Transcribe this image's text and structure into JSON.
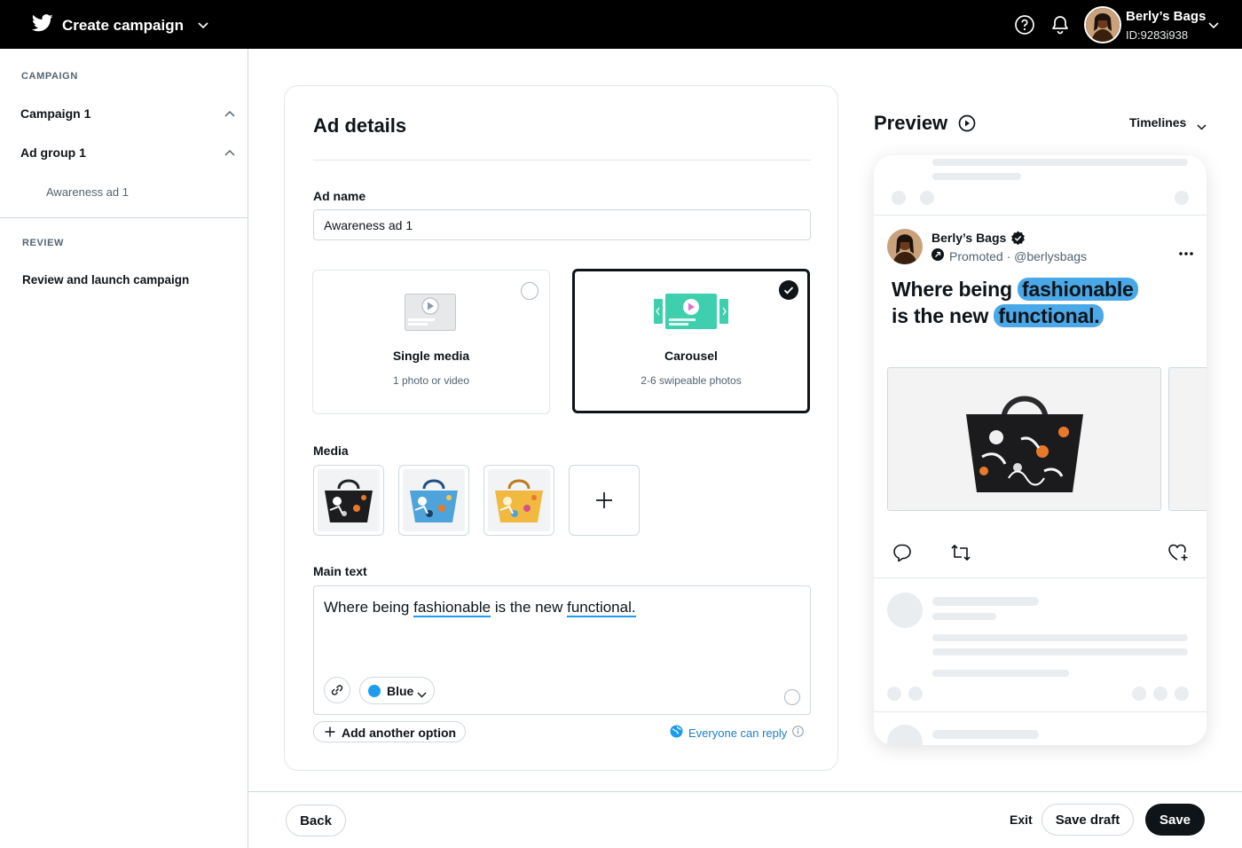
{
  "topbar": {
    "title": "Create campaign",
    "account_name": "Berly’s Bags",
    "account_id": "ID:9283i938"
  },
  "sidebar": {
    "campaign_section": "CAMPAIGN",
    "campaign_item": "Campaign 1",
    "ad_group_item": "Ad group 1",
    "ad_item": "Awareness ad 1",
    "review_section": "REVIEW",
    "review_item": "Review and launch campaign"
  },
  "ad_details": {
    "title": "Ad details",
    "ad_name_label": "Ad name",
    "ad_name_value": "Awareness ad 1",
    "formats": [
      {
        "title": "Single media",
        "desc": "1 photo or video",
        "selected": false
      },
      {
        "title": "Carousel",
        "desc": "2-6 swipeable photos",
        "selected": true
      }
    ],
    "media_label": "Media",
    "main_text_label": "Main text",
    "main_text": {
      "part1": "Where being ",
      "hl1": "fashionable",
      "part2": " is the new ",
      "hl2": "functional."
    },
    "highlight_color": "Blue",
    "highlight_hex": "#1d9bf0",
    "add_option": "Add another option",
    "reply_setting": "Everyone can reply"
  },
  "preview": {
    "title": "Preview",
    "placement": "Timelines",
    "tweet": {
      "name": "Berly’s Bags",
      "promoted": "Promoted · @berlysbags",
      "line1_text": "Where being ",
      "line1_hl": "fashionable",
      "line2_text": "is the new ",
      "line2_hl": "functional."
    }
  },
  "footer": {
    "back": "Back",
    "exit": "Exit",
    "save_draft": "Save draft",
    "save": "Save"
  }
}
